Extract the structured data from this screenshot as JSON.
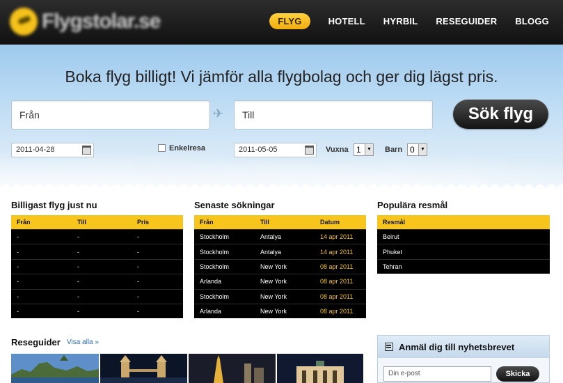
{
  "header": {
    "logo_text": "Flygstolar.se",
    "nav": [
      "FLYG",
      "HOTELL",
      "HYRBIL",
      "RESEGUIDER",
      "BLOGG"
    ]
  },
  "hero": {
    "headline": "Boka flyg billigt! Vi jämför alla flygbolag och ger dig lägst pris.",
    "from_placeholder": "Från",
    "to_placeholder": "Till",
    "search_label": "Sök flyg",
    "depart_date": "2011-04-28",
    "oneway_label": "Enkelresa",
    "return_date": "2011-05-05",
    "adults_label": "Vuxna",
    "adults_value": "1",
    "children_label": "Barn",
    "children_value": "0"
  },
  "cheapest": {
    "title": "Billigast flyg just nu",
    "headers": [
      "Från",
      "Till",
      "Pris"
    ],
    "rows": [
      [
        "-",
        "-",
        "-"
      ],
      [
        "-",
        "-",
        "-"
      ],
      [
        "-",
        "-",
        "-"
      ],
      [
        "-",
        "-",
        "-"
      ],
      [
        "-",
        "-",
        "-"
      ],
      [
        "-",
        "-",
        "-"
      ]
    ]
  },
  "recent": {
    "title": "Senaste sökningar",
    "headers": [
      "Från",
      "Till",
      "Datum"
    ],
    "rows": [
      [
        "Stockholm",
        "Antalya",
        "14 apr 2011"
      ],
      [
        "Stockholm",
        "Antalya",
        "14 apr 2011"
      ],
      [
        "Stockholm",
        "New York",
        "08 apr 2011"
      ],
      [
        "Arlanda",
        "New York",
        "08 apr 2011"
      ],
      [
        "Stockholm",
        "New York",
        "08 apr 2011"
      ],
      [
        "Arlanda",
        "New York",
        "08 apr 2011"
      ]
    ]
  },
  "popular": {
    "title": "Populära resmål",
    "header": "Resmål",
    "rows": [
      "Beirut",
      "Phuket",
      "Tehran"
    ]
  },
  "guides": {
    "title": "Reseguider",
    "link": "Visa alla »"
  },
  "newsletter": {
    "title": "Anmäl dig till nyhetsbrevet",
    "placeholder": "Din e-post",
    "button": "Skicka"
  },
  "colors": {
    "accent": "#f8c51c",
    "dark": "#111111",
    "sky": "#b9daf4"
  }
}
